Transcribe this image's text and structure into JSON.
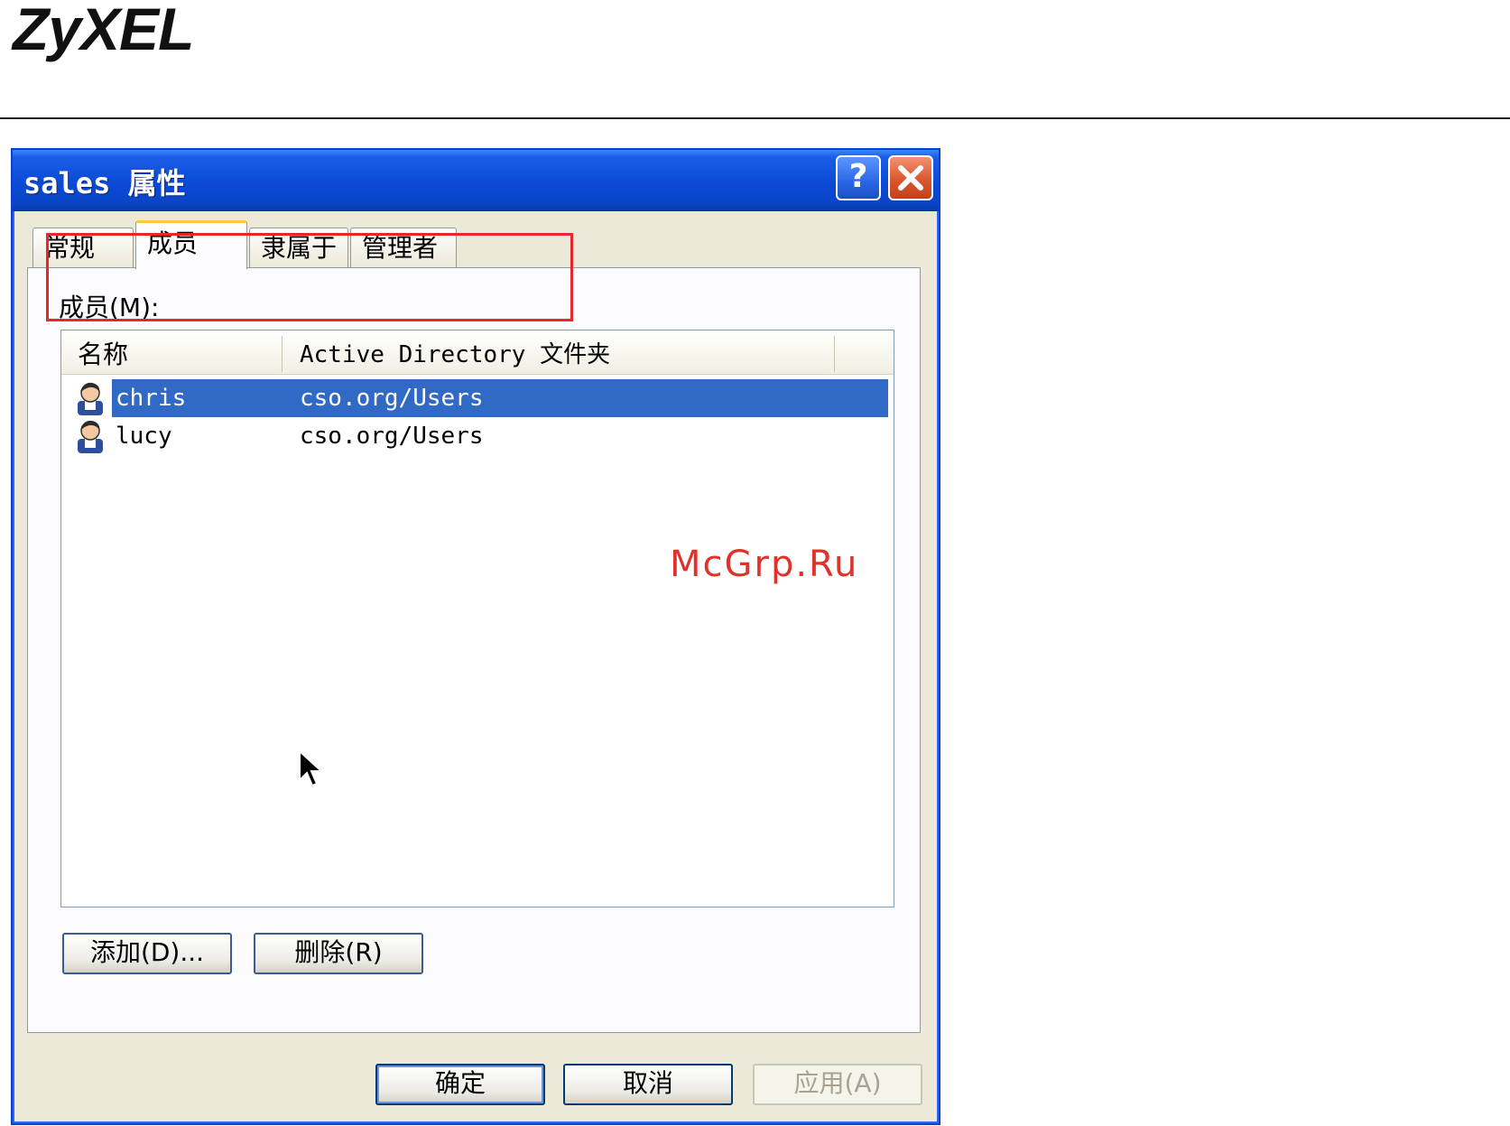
{
  "brand": {
    "logo_text": "ZyXEL"
  },
  "dialog": {
    "title": "sales 属性",
    "help_label": "?",
    "close_label": "✕",
    "tabs": [
      {
        "label": "常规",
        "active": false
      },
      {
        "label": "成员",
        "active": true
      },
      {
        "label": "隶属于",
        "active": false
      },
      {
        "label": "管理者",
        "active": false
      }
    ],
    "members_label": "成员(M):",
    "columns": {
      "name": "名称",
      "folder": "Active Directory 文件夹"
    },
    "members": [
      {
        "name": "chris",
        "folder": "cso.org/Users",
        "selected": true,
        "icon": "user-icon"
      },
      {
        "name": "lucy",
        "folder": "cso.org/Users",
        "selected": false,
        "icon": "user-icon"
      }
    ],
    "buttons": {
      "add": "添加(D)...",
      "remove": "删除(R)",
      "ok": "确定",
      "cancel": "取消",
      "apply": "应用(A)"
    }
  },
  "watermark": "McGrp.Ru",
  "colors": {
    "titlebar": "#0a4ad6",
    "selection": "#316ac5",
    "highlight": "#e8262d",
    "watermark": "#e0322a"
  }
}
